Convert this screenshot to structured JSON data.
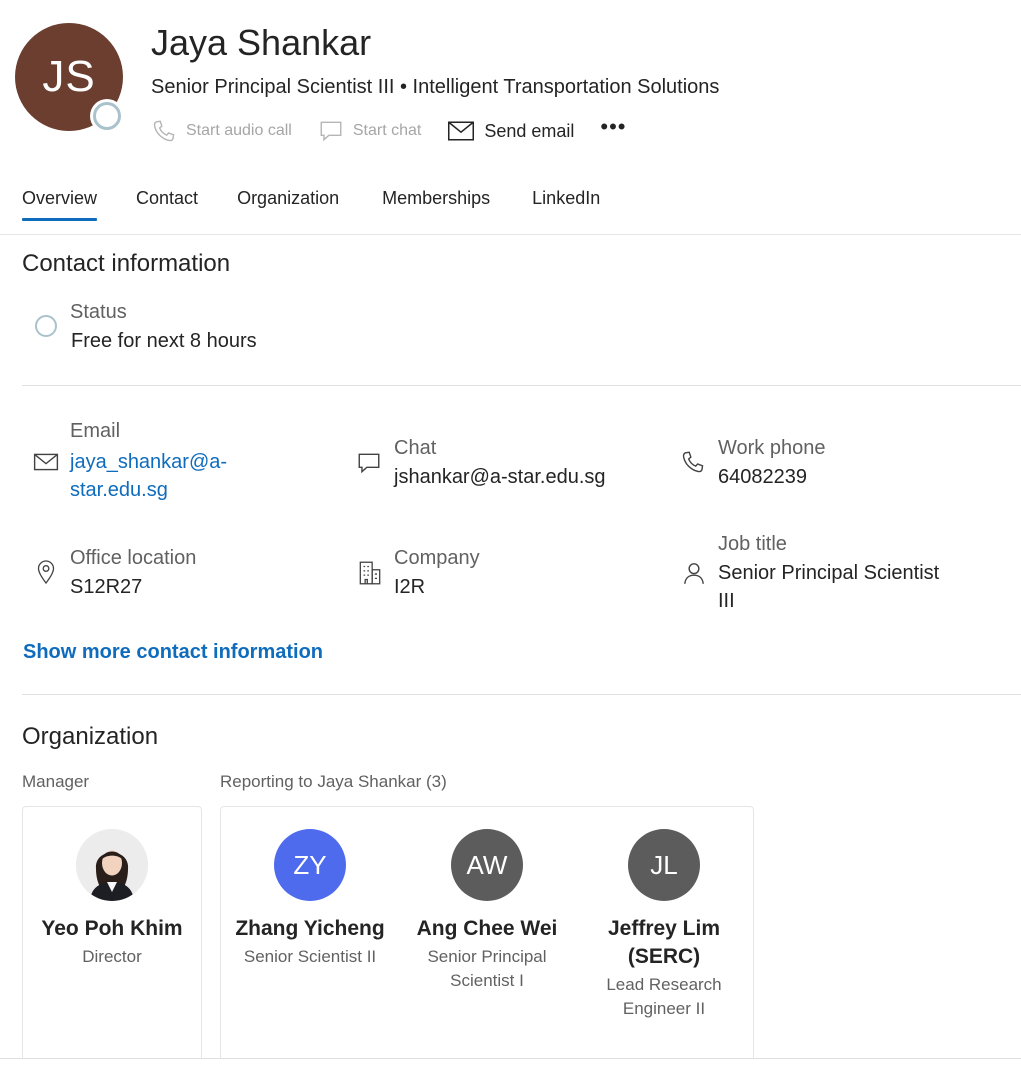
{
  "profile": {
    "initials": "JS",
    "name": "Jaya Shankar",
    "subtitle": "Senior Principal Scientist III • Intelligent Transportation Solutions"
  },
  "actions": {
    "audio_call": "Start audio call",
    "chat": "Start chat",
    "email": "Send email",
    "more": "•••"
  },
  "tabs": [
    {
      "label": "Overview",
      "active": true
    },
    {
      "label": "Contact"
    },
    {
      "label": "Organization"
    },
    {
      "label": "Memberships"
    },
    {
      "label": "LinkedIn"
    }
  ],
  "contact": {
    "title": "Contact information",
    "status_label": "Status",
    "status_value": "Free for next 8 hours",
    "email_label": "Email",
    "email_line1": "jaya_shankar@a-",
    "email_line2": "star.edu.sg",
    "chat_label": "Chat",
    "chat_value": "jshankar@a-star.edu.sg",
    "phone_label": "Work phone",
    "phone_value": "64082239",
    "office_label": "Office location",
    "office_value": "S12R27",
    "company_label": "Company",
    "company_value": "I2R",
    "job_label": "Job title",
    "job_line1": "Senior Principal Scientist",
    "job_line2": "III",
    "show_more": "Show more contact information"
  },
  "organization": {
    "title": "Organization",
    "manager_label": "Manager",
    "reports_label": "Reporting to Jaya Shankar (3)",
    "manager": {
      "name": "Yeo Poh Khim",
      "title": "Director"
    },
    "reports": [
      {
        "initials": "ZY",
        "name": "Zhang Yicheng",
        "title": "Senior Scientist II",
        "color": "#4f6bed"
      },
      {
        "initials": "AW",
        "name": "Ang Chee Wei",
        "title_line1": "Senior Principal",
        "title_line2": "Scientist I",
        "color": "#5c5c5c"
      },
      {
        "initials": "JL",
        "name_line1": "Jeffrey Lim",
        "name_line2": "(SERC)",
        "title_line1": "Lead Research",
        "title_line2": "Engineer II",
        "color": "#5c5c5c"
      }
    ]
  },
  "colors": {
    "accent": "#0f6cbd",
    "avatar_bg": "#6b3e30",
    "presence_ring": "#a9c2cc"
  }
}
